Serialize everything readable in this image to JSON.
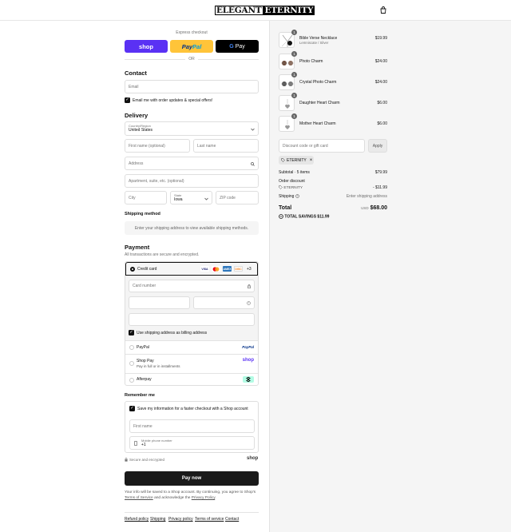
{
  "brand": {
    "part1": "ELEGANT",
    "part2": "ETERNITY"
  },
  "express": {
    "label": "Express checkout",
    "shop": "shop",
    "paypal_a": "Pay",
    "paypal_b": "Pal",
    "gpay_g": "G",
    "gpay_label": "Pay",
    "or": "OR"
  },
  "contact": {
    "heading": "Contact",
    "email_placeholder": "Email",
    "newsletter_label": "Email me with order updates & special offers!"
  },
  "delivery": {
    "heading": "Delivery",
    "country_label": "Country/Region",
    "country_value": "United States",
    "first_name": "First name (optional)",
    "last_name": "Last name",
    "address": "Address",
    "apartment": "Apartment, suite, etc. (optional)",
    "city": "City",
    "state_label": "State",
    "state_value": "Iowa",
    "zip": "ZIP code"
  },
  "shipping_method": {
    "heading": "Shipping method",
    "message": "Enter your shipping address to view available shipping methods."
  },
  "payment": {
    "heading": "Payment",
    "subtitle": "All transactions are secure and encrypted.",
    "credit_card_label": "Credit card",
    "card_logos": [
      "VISA",
      "MC",
      "AMEX",
      "DISC"
    ],
    "more_cards": "+3",
    "card_number": "Card number",
    "billing_label": "Use shipping address as billing address",
    "paypal_label": "PayPal",
    "paypal_logo": "PayPal",
    "shoppay_label": "Shop Pay",
    "shoppay_sub": "Pay in full or in installments",
    "shoppay_logo": "shop",
    "afterpay_label": "Afterpay"
  },
  "remember": {
    "heading": "Remember me",
    "save_label": "Save my information for a faster checkout with a Shop account",
    "first_name": "First name",
    "phone_label": "Mobile phone number",
    "phone_value": "+1",
    "secure_label": "Secure and encrypted",
    "shop_logo": "shop"
  },
  "pay_now": "Pay now",
  "legal": {
    "text1": "Your info will be saved to a Shop account. By continuing, you agree to Shop's",
    "terms": "Terms of Service",
    "text2": "and acknowledge the",
    "privacy": "Privacy Policy",
    "text3": "."
  },
  "footer": [
    "Refund policy",
    "Shipping",
    "Privacy policy",
    "Terms of service",
    "Contact"
  ],
  "summary": {
    "items": [
      {
        "qty": "1",
        "name": "Bible Verse Necklace",
        "variant": "Lemniscate / Silver",
        "price": "$19.99"
      },
      {
        "qty": "1",
        "name": "Photo Charm",
        "variant": "",
        "price": "$24.00"
      },
      {
        "qty": "1",
        "name": "Crystal Photo Charm",
        "variant": "",
        "price": "$24.00"
      },
      {
        "qty": "1",
        "name": "Daughter Heart Charm",
        "variant": "",
        "price": "$6.00"
      },
      {
        "qty": "1",
        "name": "Mother Heart Charm",
        "variant": "",
        "price": "$6.00"
      }
    ],
    "discount_placeholder": "Discount code or gift card",
    "apply": "Apply",
    "applied_code": "ETERNITY",
    "subtotal_label": "Subtotal · 5 items",
    "subtotal_value": "$79.99",
    "order_discount_label": "Order discount",
    "discount_code": "ETERNITY",
    "discount_value": "- $11.99",
    "shipping_label": "Shipping",
    "shipping_value": "Enter shipping address",
    "total_label": "Total",
    "currency": "USD",
    "total_value": "$68.00",
    "savings_label": "TOTAL SAVINGS",
    "savings_value": "$11.99"
  },
  "colors": {
    "shop": "#5a31f4",
    "paypal": "#ffc439",
    "gpay": "#000000",
    "afterpay": "#b2fce4"
  }
}
